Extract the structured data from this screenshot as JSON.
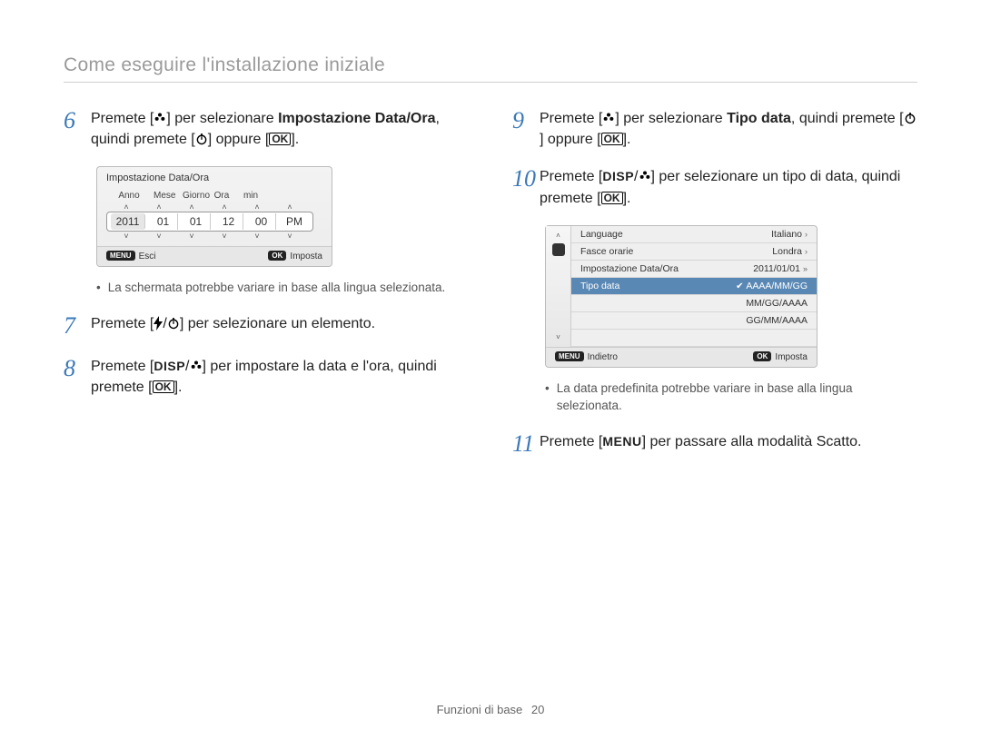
{
  "page_title": "Come eseguire l'installazione iniziale",
  "footer": {
    "section": "Funzioni di base",
    "page": "20"
  },
  "ok_label": "OK",
  "disp_label": "DISP",
  "menu_label": "MENU",
  "steps": {
    "s6": {
      "num": "6",
      "a": "Premete [",
      "b": "] per selezionare ",
      "bold": "Impostazione Data/Ora",
      "c": ", quindi premete [",
      "d": "] oppure [",
      "e": "]."
    },
    "s7": {
      "num": "7",
      "a": "Premete [",
      "b": "/",
      "c": "] per selezionare un elemento."
    },
    "s8": {
      "num": "8",
      "a": "Premete [",
      "b": "/",
      "c": "] per impostare la data e l'ora, quindi premete [",
      "d": "]."
    },
    "s9": {
      "num": "9",
      "a": "Premete [",
      "b": "] per selezionare ",
      "bold": "Tipo data",
      "c": ", quindi premete [",
      "d": "] oppure [",
      "e": "]."
    },
    "s10": {
      "num": "10",
      "a": "Premete [",
      "b": "/",
      "c": "] per selezionare un tipo di data, quindi premete [",
      "d": "]."
    },
    "s11": {
      "num": "11",
      "a": "Premete [",
      "b": "] per passare alla modalità Scatto."
    }
  },
  "notes": {
    "left": "La schermata potrebbe variare in base alla lingua selezionata.",
    "right": "La data predefinita potrebbe variare in base alla lingua selezionata."
  },
  "fig_left": {
    "title": "Impostazione Data/Ora",
    "headers": {
      "anno": "Anno",
      "mese": "Mese",
      "giorno": "Giorno",
      "ora": "Ora",
      "min": "min"
    },
    "values": {
      "anno": "2011",
      "mese": "01",
      "giorno": "01",
      "ora": "12",
      "min": "00",
      "ampm": "PM"
    },
    "foot_left_pill": "MENU",
    "foot_left": "Esci",
    "foot_right_pill": "OK",
    "foot_right": "Imposta"
  },
  "fig_right": {
    "rows": {
      "lang_l": "Language",
      "lang_v": "Italiano",
      "tz_l": "Fasce orarie",
      "tz_v": "Londra",
      "dt_l": "Impostazione Data/Ora",
      "dt_v": "2011/01/01",
      "type_l": "Tipo data",
      "type_v": "AAAA/MM/GG",
      "opt2": "MM/GG/AAAA",
      "opt3": "GG/MM/AAAA"
    },
    "foot_left_pill": "MENU",
    "foot_left": "Indietro",
    "foot_right_pill": "OK",
    "foot_right": "Imposta"
  }
}
